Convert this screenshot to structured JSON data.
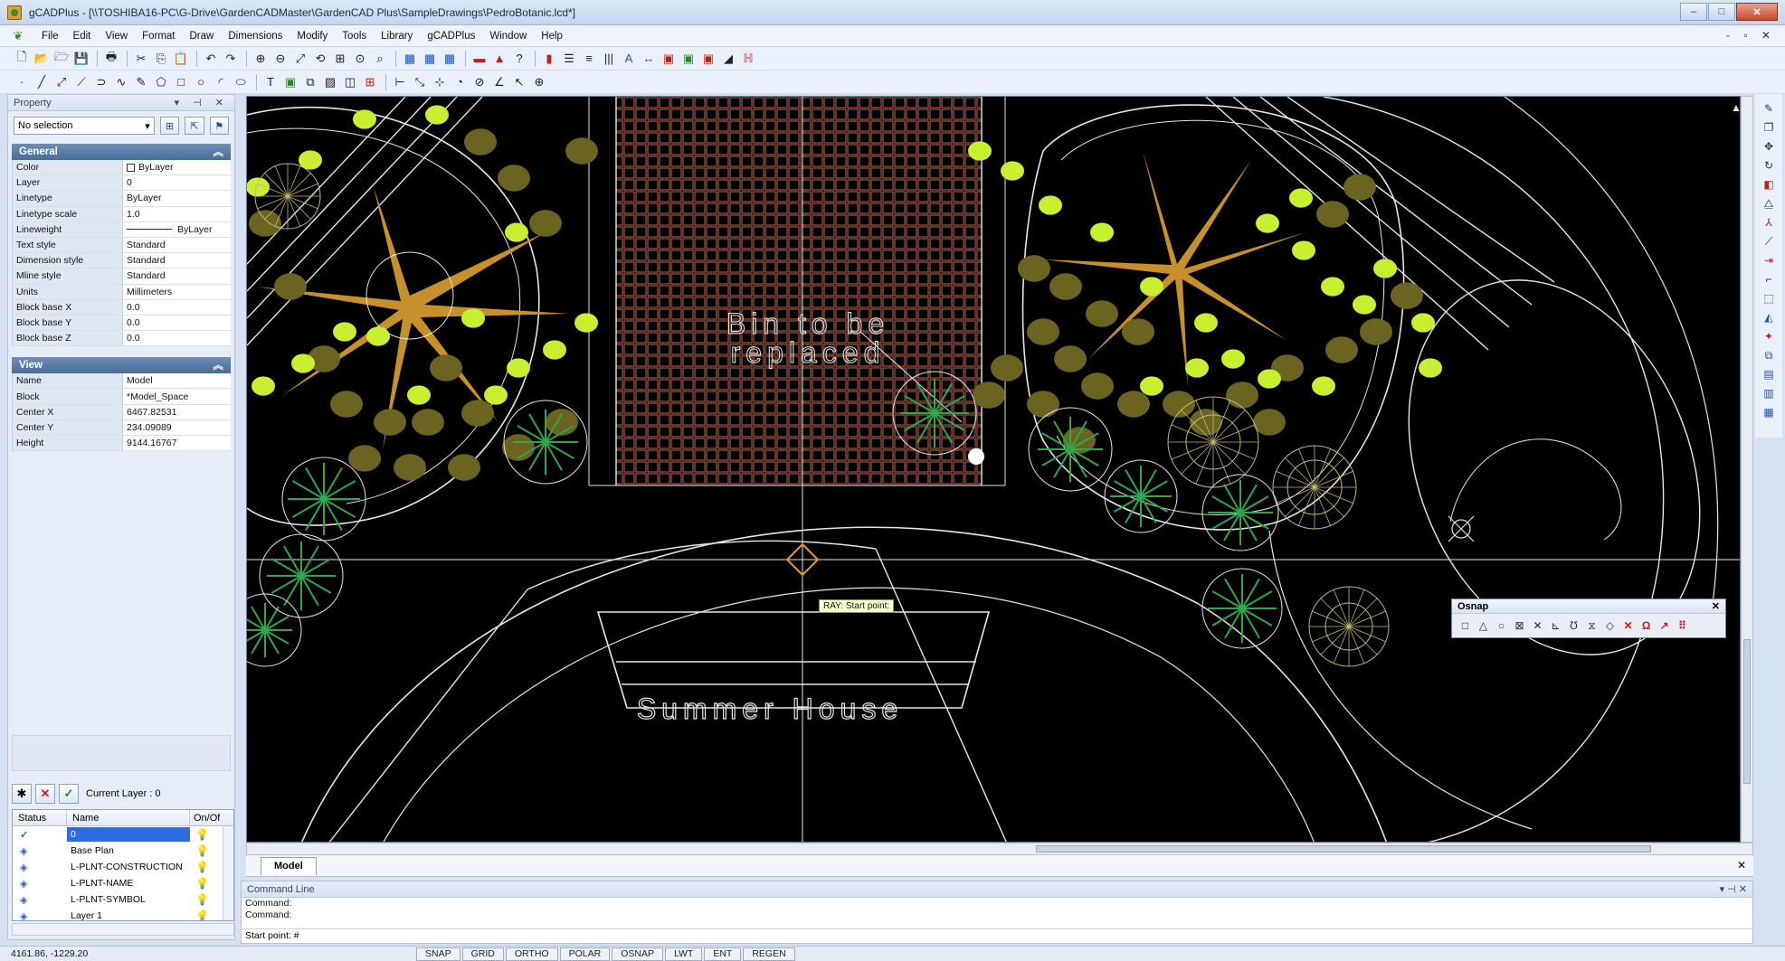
{
  "window": {
    "title": "gCADPlus - [\\\\TOSHIBA16-PC\\G-Drive\\GardenCADMaster\\GardenCAD Plus\\SampleDrawings\\PedroBotanic.lcd*]",
    "minimize": "–",
    "maximize": "□",
    "close": "✕"
  },
  "menu": {
    "items": [
      "File",
      "Edit",
      "View",
      "Format",
      "Draw",
      "Dimensions",
      "Modify",
      "Tools",
      "Library",
      "gCADPlus",
      "Window",
      "Help"
    ],
    "mdi_controls": "- ▫ ✕"
  },
  "property_panel": {
    "title": "Property",
    "controls": "▾ ⊣ ✕",
    "selection": "No selection",
    "general": {
      "title": "General",
      "rows": [
        {
          "key": "Color",
          "value": "ByLayer"
        },
        {
          "key": "Layer",
          "value": "0"
        },
        {
          "key": "Linetype",
          "value": "ByLayer"
        },
        {
          "key": "Linetype scale",
          "value": "1.0"
        },
        {
          "key": "Lineweight",
          "value": "ByLayer"
        },
        {
          "key": "Text style",
          "value": "Standard"
        },
        {
          "key": "Dimension style",
          "value": "Standard"
        },
        {
          "key": "Mline style",
          "value": "Standard"
        },
        {
          "key": "Units",
          "value": "Millimeters"
        },
        {
          "key": "Block base X",
          "value": "0.0"
        },
        {
          "key": "Block base Y",
          "value": "0.0"
        },
        {
          "key": "Block base Z",
          "value": "0.0"
        }
      ]
    },
    "view": {
      "title": "View",
      "rows": [
        {
          "key": "Name",
          "value": "Model"
        },
        {
          "key": "Block",
          "value": "*Model_Space"
        },
        {
          "key": "Center X",
          "value": "6467.82531"
        },
        {
          "key": "Center Y",
          "value": "234.09089"
        },
        {
          "key": "Height",
          "value": "9144.16767"
        }
      ]
    }
  },
  "layers": {
    "current_layer_label": "Current Layer : 0",
    "columns": {
      "status": "Status",
      "name": "Name",
      "on": "On/Of"
    },
    "rows": [
      {
        "status": "✓",
        "name": "0",
        "selected": true
      },
      {
        "status": "◈",
        "name": "Base Plan",
        "selected": false
      },
      {
        "status": "◈",
        "name": "L-PLNT-CONSTRUCTION",
        "selected": false
      },
      {
        "status": "◈",
        "name": "L-PLNT-NAME",
        "selected": false
      },
      {
        "status": "◈",
        "name": "L-PLNT-SYMBOL",
        "selected": false
      },
      {
        "status": "◈",
        "name": "Layer 1",
        "selected": false
      }
    ]
  },
  "drawing": {
    "label_bin": [
      "Bin to be",
      "replaced"
    ],
    "label_summer_house": "Summer House",
    "tooltip": "RAY: Start point:"
  },
  "tabs": {
    "model": "Model",
    "close": "✕"
  },
  "osnap": {
    "title": "Osnap",
    "close": "✕",
    "buttons": [
      "□",
      "△",
      "○",
      "⊠",
      "✕",
      "⊾",
      "Ʊ",
      "⧖",
      "◇",
      "✕",
      "Ω",
      "↗",
      "⠿"
    ]
  },
  "command_line": {
    "title": "Command Line",
    "controls": "▾ ⊣ ✕",
    "history": [
      "Command:",
      "Command:"
    ],
    "prompt": "Start point: #"
  },
  "status_bar": {
    "coords": "4161.86, -1229.20",
    "buttons": [
      "SNAP",
      "GRID",
      "ORTHO",
      "POLAR",
      "OSNAP",
      "LWT",
      "ENT",
      "REGEN"
    ]
  },
  "colors": {
    "canvas_bg": "#000000",
    "shrub_light": "#c8f030",
    "shrub_dark": "#6b6320",
    "tree_orange": "#c8902a",
    "palm_green": "#2ea84a",
    "paving": "#8a4a38",
    "linework": "#e6e6e6"
  }
}
